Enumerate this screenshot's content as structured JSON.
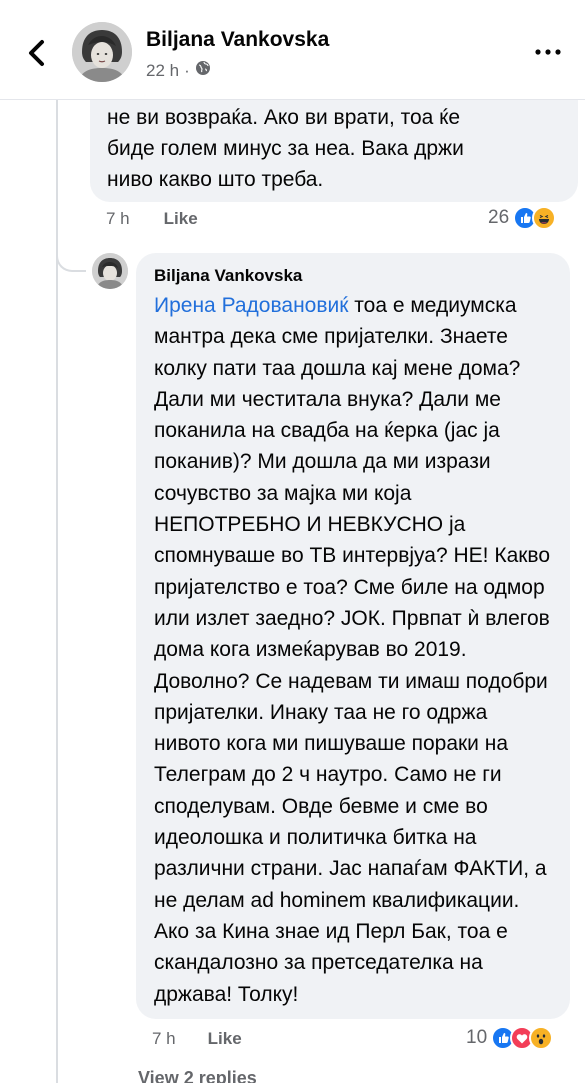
{
  "header": {
    "name": "Biljana Vankovska",
    "time": "22 h",
    "dot": "·"
  },
  "comment1": {
    "text": "не ви возвраќа. Ако ви врати, тоа ќе\nбиде голем минус за неа. Вака држи\nниво какво што треба.",
    "time": "7 h",
    "like_label": "Like",
    "reaction_count": "26",
    "reactions": [
      "like",
      "haha"
    ]
  },
  "reply": {
    "author": "Biljana Vankovska",
    "mention": "Ирена Радовановиќ",
    "text": " тоа е медиумска мантра дека сме пријателки. Знаете колку пати таа дошла кај мене дома? Дали ми честитала внука? Дали ме поканила на свадба на ќерка (јас ја поканив)? Ми дошла да ми изрази сочувство за мајка ми која НЕПОТРЕБНО И НЕВКУСНО ја спомнуваше во ТВ интервјуа? НЕ! Какво пријателство е тоа? Сме биле на одмор или излет заедно? ЈОК. Првпат ѝ влегов дома кога измеќарував во 2019. Доволно? Се надевам ти имаш подобри пријателки. Инаку таа не го одржа нивото кога ми пишуваше пораки на Телеграм до 2 ч наутро. Само не ги споделувам. Овде бевме и сме во идеолошка и политичка битка на различни страни. Јас напаѓам ФАКТИ, а не делам ad hominem квалификации. Ако за Кина знае ид Перл Бак, тоа е скандалозно за претседателка на држава! Толку!",
    "time": "7 h",
    "like_label": "Like",
    "reaction_count": "10",
    "reactions": [
      "like",
      "love",
      "wow"
    ]
  },
  "view_replies": "View 2 replies",
  "colors": {
    "bubble": "#f0f2f5",
    "secondary_text": "#65676b",
    "mention": "#216fdb",
    "like_blue": "#1877f2"
  }
}
